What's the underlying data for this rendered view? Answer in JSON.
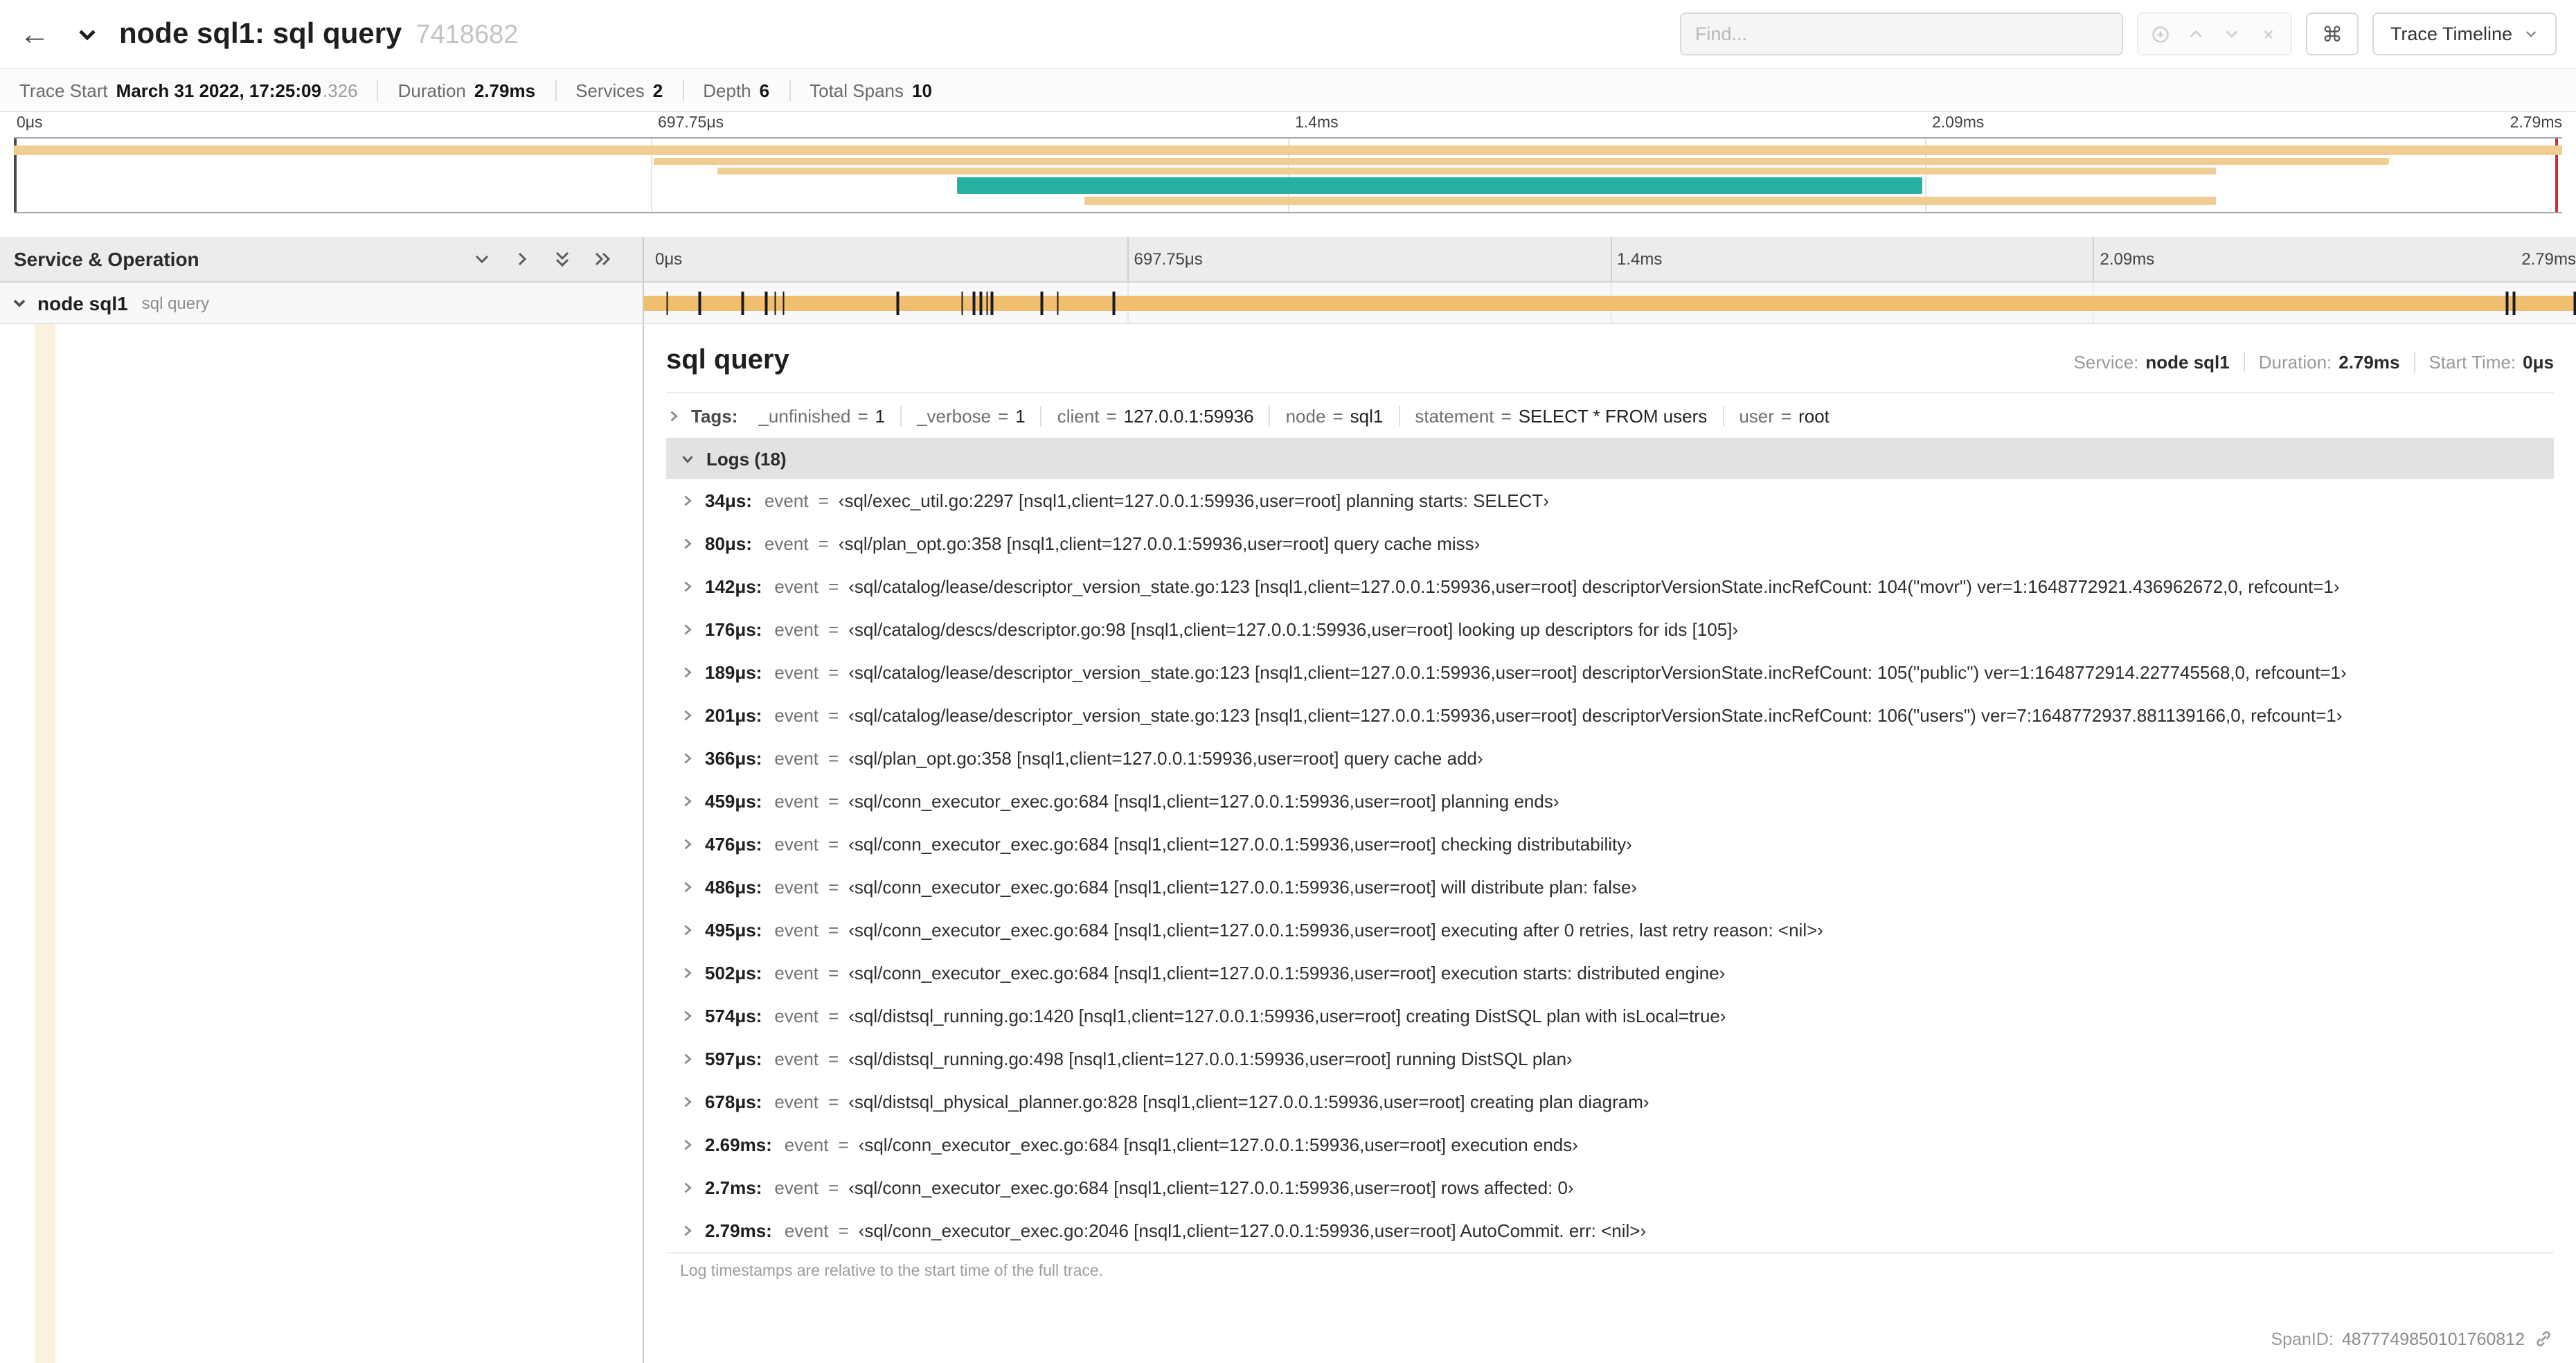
{
  "colors": {
    "minimap_tan": "#F2CD93",
    "minimap_teal": "#27B1A2",
    "row_span_tan": "#EFBE6F",
    "detail_strip_cream": "#FBF1DC",
    "scrubber_left": "#4A4A4A",
    "scrubber_right": "#DB2828"
  },
  "header": {
    "back_icon": "←",
    "title": "node sql1: sql query",
    "trace_id": "7418682",
    "find_placeholder": "Find...",
    "shortcut_key": "⌘",
    "view_button": "Trace Timeline"
  },
  "summary": {
    "items": [
      {
        "label": "Trace Start",
        "value": "March 31 2022, 17:25:09",
        "suffix": ".326"
      },
      {
        "label": "Duration",
        "value": "2.79ms"
      },
      {
        "label": "Services",
        "value": "2"
      },
      {
        "label": "Depth",
        "value": "6"
      },
      {
        "label": "Total Spans",
        "value": "10"
      }
    ]
  },
  "ruler_ticks": [
    "0μs",
    "697.75μs",
    "1.4ms",
    "2.09ms",
    "2.79ms"
  ],
  "timeline": {
    "left_header": "Service & Operation",
    "span_service": "node sql1",
    "span_operation": "sql query"
  },
  "detail": {
    "title": "sql query",
    "overview": [
      {
        "label": "Service:",
        "value": "node sql1"
      },
      {
        "label": "Duration:",
        "value": "2.79ms"
      },
      {
        "label": "Start Time:",
        "value": "0μs"
      }
    ],
    "tags_label": "Tags:",
    "tag_eq": "=",
    "log_eq": "=",
    "tags": [
      {
        "key": "_unfinished",
        "value": "1"
      },
      {
        "key": "_verbose",
        "value": "1"
      },
      {
        "key": "client",
        "value": "127.0.0.1:59936"
      },
      {
        "key": "node",
        "value": "sql1"
      },
      {
        "key": "statement",
        "value": "SELECT * FROM users"
      },
      {
        "key": "user",
        "value": "root"
      }
    ],
    "logs_label": "Logs (18)",
    "logs": [
      {
        "time": "34μs:",
        "key": "event",
        "value": "‹sql/exec_util.go:2297 [nsql1,client=127.0.0.1:59936,user=root] planning starts: SELECT›"
      },
      {
        "time": "80μs:",
        "key": "event",
        "value": "‹sql/plan_opt.go:358 [nsql1,client=127.0.0.1:59936,user=root] query cache miss›"
      },
      {
        "time": "142μs:",
        "key": "event",
        "value": "‹sql/catalog/lease/descriptor_version_state.go:123 [nsql1,client=127.0.0.1:59936,user=root] descriptorVersionState.incRefCount: 104(\"movr\") ver=1:1648772921.436962672,0, refcount=1›"
      },
      {
        "time": "176μs:",
        "key": "event",
        "value": "‹sql/catalog/descs/descriptor.go:98 [nsql1,client=127.0.0.1:59936,user=root] looking up descriptors for ids [105]›"
      },
      {
        "time": "189μs:",
        "key": "event",
        "value": "‹sql/catalog/lease/descriptor_version_state.go:123 [nsql1,client=127.0.0.1:59936,user=root] descriptorVersionState.incRefCount: 105(\"public\") ver=1:1648772914.227745568,0, refcount=1›"
      },
      {
        "time": "201μs:",
        "key": "event",
        "value": "‹sql/catalog/lease/descriptor_version_state.go:123 [nsql1,client=127.0.0.1:59936,user=root] descriptorVersionState.incRefCount: 106(\"users\") ver=7:1648772937.881139166,0, refcount=1›"
      },
      {
        "time": "366μs:",
        "key": "event",
        "value": "‹sql/plan_opt.go:358 [nsql1,client=127.0.0.1:59936,user=root] query cache add›"
      },
      {
        "time": "459μs:",
        "key": "event",
        "value": "‹sql/conn_executor_exec.go:684 [nsql1,client=127.0.0.1:59936,user=root] planning ends›"
      },
      {
        "time": "476μs:",
        "key": "event",
        "value": "‹sql/conn_executor_exec.go:684 [nsql1,client=127.0.0.1:59936,user=root] checking distributability›"
      },
      {
        "time": "486μs:",
        "key": "event",
        "value": "‹sql/conn_executor_exec.go:684 [nsql1,client=127.0.0.1:59936,user=root] will distribute plan: false›"
      },
      {
        "time": "495μs:",
        "key": "event",
        "value": "‹sql/conn_executor_exec.go:684 [nsql1,client=127.0.0.1:59936,user=root] executing after 0 retries, last retry reason: <nil>›"
      },
      {
        "time": "502μs:",
        "key": "event",
        "value": "‹sql/conn_executor_exec.go:684 [nsql1,client=127.0.0.1:59936,user=root] execution starts: distributed engine›"
      },
      {
        "time": "574μs:",
        "key": "event",
        "value": "‹sql/distsql_running.go:1420 [nsql1,client=127.0.0.1:59936,user=root] creating DistSQL plan with isLocal=true›"
      },
      {
        "time": "597μs:",
        "key": "event",
        "value": "‹sql/distsql_running.go:498 [nsql1,client=127.0.0.1:59936,user=root] running DistSQL plan›"
      },
      {
        "time": "678μs:",
        "key": "event",
        "value": "‹sql/distsql_physical_planner.go:828 [nsql1,client=127.0.0.1:59936,user=root] creating plan diagram›"
      },
      {
        "time": "2.69ms:",
        "key": "event",
        "value": "‹sql/conn_executor_exec.go:684 [nsql1,client=127.0.0.1:59936,user=root] execution ends›"
      },
      {
        "time": "2.7ms:",
        "key": "event",
        "value": "‹sql/conn_executor_exec.go:684 [nsql1,client=127.0.0.1:59936,user=root] rows affected: 0›"
      },
      {
        "time": "2.79ms:",
        "key": "event",
        "value": "‹sql/conn_executor_exec.go:2046 [nsql1,client=127.0.0.1:59936,user=root] AutoCommit. err: <nil>›"
      }
    ],
    "logs_note": "Log timestamps are relative to the start time of the full trace.",
    "span_id_label": "SpanID:",
    "span_id": "4877749850101760812"
  },
  "chart_data": {
    "type": "gantt",
    "title": "Jaeger trace timeline — node sql1: sql query",
    "total_duration_ms": 2.79,
    "axis_ticks": [
      "0μs",
      "697.75μs",
      "1.4ms",
      "2.09ms",
      "2.79ms"
    ],
    "services": 2,
    "depth": 6,
    "total_spans": 10,
    "minimap_spans": [
      {
        "row": 0,
        "start_pct": 0,
        "end_pct": 100,
        "color": "#F2CD93"
      },
      {
        "row": 1,
        "start_pct": 25.1,
        "end_pct": 93.2,
        "color": "#F2CD93"
      },
      {
        "row": 2,
        "start_pct": 27.6,
        "end_pct": 86.4,
        "color": "#F2CD93"
      },
      {
        "row": 3,
        "start_pct": 37.0,
        "end_pct": 74.9,
        "color": "#27B1A2"
      },
      {
        "row": 4,
        "start_pct": 42.0,
        "end_pct": 86.4,
        "color": "#F2CD93"
      }
    ],
    "selected_span": {
      "service": "node sql1",
      "operation": "sql query",
      "start_pct": 0,
      "end_pct": 100,
      "color": "#EFBE6F",
      "total_us": 2790,
      "log_ticks_us": [
        34,
        80,
        142,
        176,
        189,
        201,
        366,
        459,
        476,
        486,
        495,
        502,
        574,
        597,
        678,
        2690,
        2700,
        2790
      ]
    }
  }
}
